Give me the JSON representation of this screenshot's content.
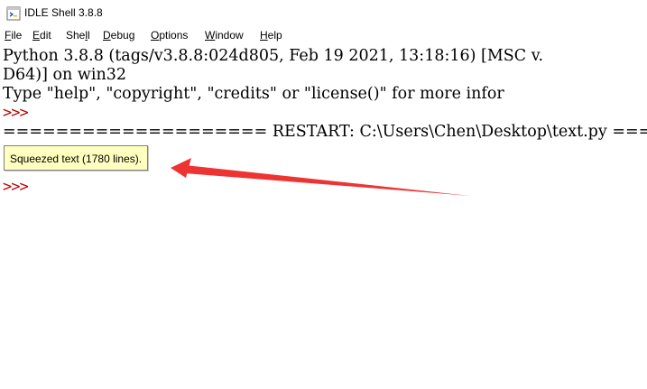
{
  "window": {
    "title": "IDLE Shell 3.8.8"
  },
  "menubar": {
    "items": [
      {
        "mnemonic": "F",
        "rest": "ile"
      },
      {
        "mnemonic": "E",
        "rest": "dit"
      },
      {
        "pre": "She",
        "mnemonic": "l",
        "rest": "l"
      },
      {
        "mnemonic": "D",
        "rest": "ebug"
      },
      {
        "mnemonic": "O",
        "rest": "ptions"
      },
      {
        "mnemonic": "W",
        "rest": "indow"
      },
      {
        "mnemonic": "H",
        "rest": "elp"
      }
    ]
  },
  "shell": {
    "banner_line1": "Python 3.8.8 (tags/v3.8.8:024d805, Feb 19 2021, 13:18:16) [MSC v.",
    "banner_line2": "D64)] on win32",
    "banner_line3": "Type \"help\", \"copyright\", \"credits\" or \"license()\" for more infor",
    "prompt": ">>>",
    "restart_line": "==================== RESTART: C:\\Users\\Chen\\Desktop\\text.py =====",
    "squeezed_label": "Squeezed text (1780 lines)."
  },
  "colors": {
    "prompt": "#c00000",
    "squeezed_bg": "#ffffc0",
    "annotation_arrow": "#ee3333"
  },
  "icons": {
    "app": "idle-python-icon",
    "annotation": "red-arrow-annotation"
  }
}
